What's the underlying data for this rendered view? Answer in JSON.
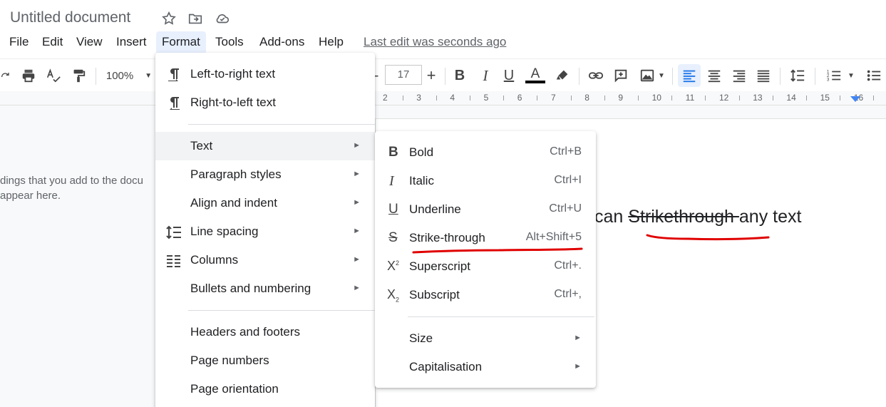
{
  "titlebar": {
    "doc_title": "Untitled document",
    "icons": [
      "star-icon",
      "move-folder-icon",
      "cloud-status-icon"
    ]
  },
  "menubar": {
    "items": [
      "File",
      "Edit",
      "View",
      "Insert",
      "Format",
      "Tools",
      "Add-ons",
      "Help"
    ],
    "active": "Format",
    "last_edit": "Last edit was seconds ago"
  },
  "toolbar": {
    "zoom": "100%",
    "font_size": "17",
    "minus": "-",
    "plus": "+"
  },
  "ruler": {
    "numbers": [
      "2",
      "3",
      "4",
      "5",
      "6",
      "7",
      "8",
      "9",
      "10",
      "11",
      "12",
      "13",
      "14",
      "15",
      "16"
    ]
  },
  "outline": {
    "line1": "dings that you add to the docu",
    "line2": "appear here."
  },
  "document": {
    "before": "can ",
    "strike": "Strikethrough ",
    "after": "any text"
  },
  "format_menu": {
    "items": [
      {
        "label": "Left-to-right text",
        "icon": "ltr-icon"
      },
      {
        "label": "Right-to-left text",
        "icon": "rtl-icon"
      },
      {
        "label": "Text",
        "submenu": true,
        "highlighted": true
      },
      {
        "label": "Paragraph styles",
        "submenu": true
      },
      {
        "label": "Align and indent",
        "submenu": true
      },
      {
        "label": "Line spacing",
        "submenu": true,
        "icon": "line-spacing-icon"
      },
      {
        "label": "Columns",
        "submenu": true,
        "icon": "columns-icon"
      },
      {
        "label": "Bullets and numbering",
        "submenu": true
      },
      {
        "label": "Headers and footers"
      },
      {
        "label": "Page numbers"
      },
      {
        "label": "Page orientation"
      }
    ],
    "arrow": "►"
  },
  "text_menu": {
    "items": [
      {
        "label": "Bold",
        "shortcut": "Ctrl+B",
        "icon": "bold-icon"
      },
      {
        "label": "Italic",
        "shortcut": "Ctrl+I",
        "icon": "italic-icon"
      },
      {
        "label": "Underline",
        "shortcut": "Ctrl+U",
        "icon": "underline-icon"
      },
      {
        "label": "Strike-through",
        "shortcut": "Alt+Shift+5",
        "icon": "strikethrough-icon"
      },
      {
        "label": "Superscript",
        "shortcut": "Ctrl+.",
        "icon": "superscript-icon"
      },
      {
        "label": "Subscript",
        "shortcut": "Ctrl+,",
        "icon": "subscript-icon"
      },
      {
        "label": "Size",
        "submenu": true
      },
      {
        "label": "Capitalisation",
        "submenu": true
      }
    ]
  },
  "colors": {
    "accent": "#1a73e8",
    "annotation": "#e00000",
    "menu_hover": "#f1f3f4",
    "active_menu": "#e8f0fe"
  }
}
